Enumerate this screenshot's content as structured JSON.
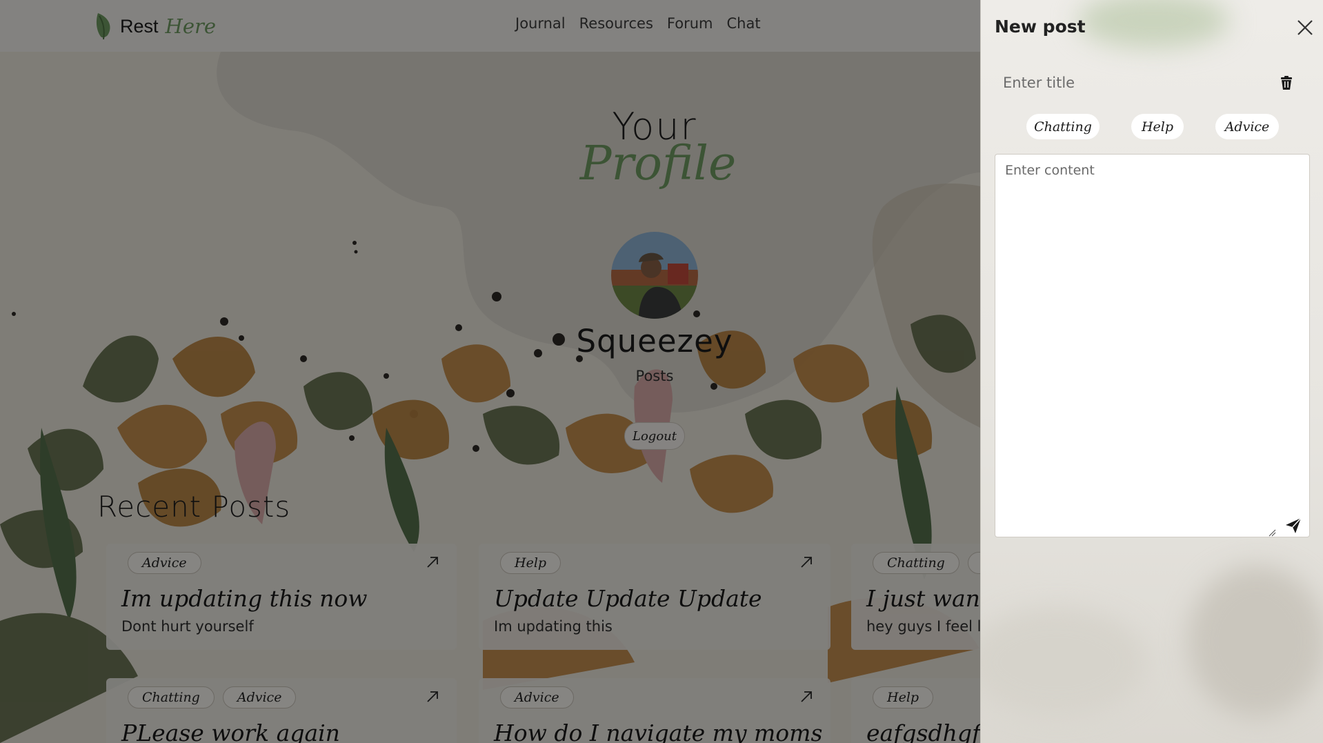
{
  "brand": {
    "word": "Rest",
    "script": "Here"
  },
  "nav": {
    "links": [
      "Journal",
      "Resources",
      "Forum",
      "Chat"
    ]
  },
  "profile": {
    "heading_top": "Your",
    "heading_bottom": "Profile",
    "username": "Squeezey",
    "posts_label": "Posts",
    "logout_label": "Logout"
  },
  "recent_posts": {
    "title": "Recent Posts",
    "cards": [
      {
        "tags": [
          "Advice"
        ],
        "title": "Im updating this now",
        "body": "Dont hurt yourself"
      },
      {
        "tags": [
          "Help"
        ],
        "title": "Update Update Update",
        "body": "Im updating this"
      },
      {
        "tags": [
          "Chatting",
          "H"
        ],
        "title": "I just wann",
        "body": "hey guys I feel lo"
      },
      {
        "tags": [
          "Chatting",
          "Advice"
        ],
        "title": "PLease work again",
        "body": ""
      },
      {
        "tags": [
          "Advice"
        ],
        "title": "How do I navigate my moms",
        "body": ""
      },
      {
        "tags": [
          "Help"
        ],
        "title": "eafgsdhgfj",
        "body": ""
      }
    ]
  },
  "new_post": {
    "panel_title": "New post",
    "title_placeholder": "Enter title",
    "content_placeholder": "Enter content",
    "categories": [
      "Chatting",
      "Help",
      "Advice"
    ]
  },
  "icons": {
    "brand": "leaf-icon",
    "card_link": "arrow-up-right-icon",
    "close": "close-icon",
    "delete": "trash-icon",
    "send": "send-icon"
  },
  "colors": {
    "accent_green": "#6f9c62",
    "nav_bg": "#f2f0ec",
    "overlay": "rgba(0,0,0,0.46)"
  }
}
